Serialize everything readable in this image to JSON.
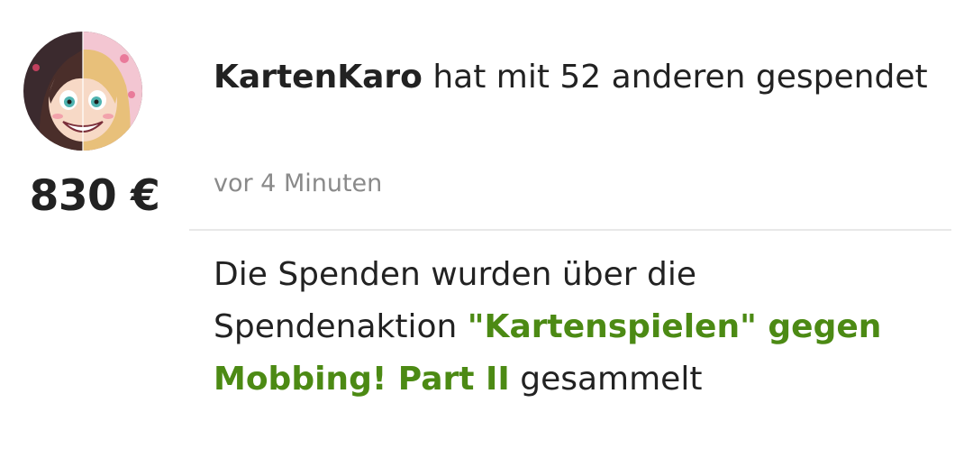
{
  "donation": {
    "avatar_icon": "user-avatar-illustration",
    "amount": "830 €",
    "donor_name": "KartenKaro",
    "headline_rest": " hat mit 52 anderen gespendet",
    "timestamp": "vor 4 Minuten"
  },
  "campaign": {
    "prefix": "Die Spenden wurden über die Spendenaktion ",
    "name": "\"Kartenspielen\" gegen Mobbing! Part II",
    "suffix": " gesammelt",
    "link_color": "#4c8a14"
  }
}
